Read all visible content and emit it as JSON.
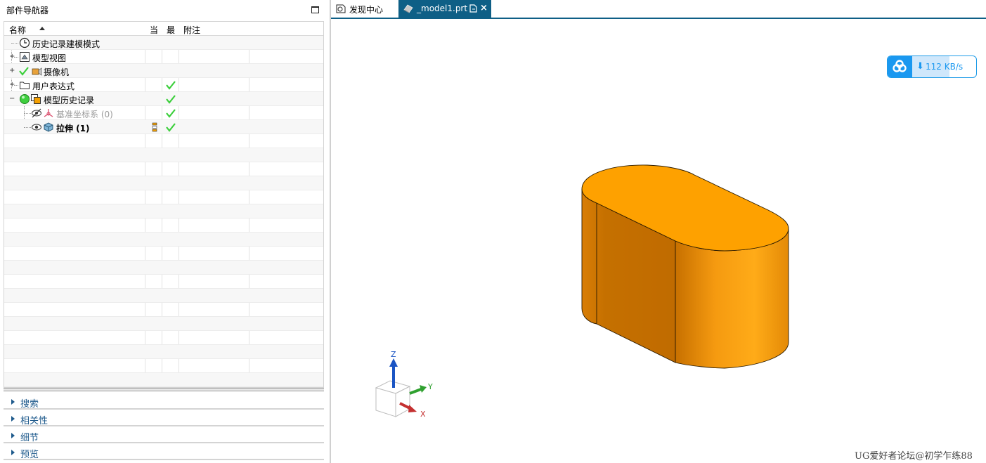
{
  "navigator": {
    "title": "部件导航器",
    "columns": {
      "name": "名称",
      "current": "当",
      "latest": "最",
      "comment": "附注"
    },
    "rows": [
      {
        "label": "历史记录建模模式",
        "latest_ok": false
      },
      {
        "label": "模型视图",
        "latest_ok": false
      },
      {
        "label": "摄像机",
        "latest_ok": false
      },
      {
        "label": "用户表达式",
        "latest_ok": true
      },
      {
        "label": "模型历史记录",
        "latest_ok": true
      },
      {
        "label": "基准坐标系 (0)",
        "latest_ok": true
      },
      {
        "label": "拉伸 (1)",
        "latest_ok": true
      }
    ],
    "sections": [
      "搜索",
      "相关性",
      "细节",
      "预览"
    ]
  },
  "tabs": {
    "discover": "发现中心",
    "model": "_model1.prt",
    "close_glyph": "×"
  },
  "viewport": {
    "speed": {
      "arrow": "⬇",
      "text": "112 KB/s",
      "fill_fraction": 0.58
    },
    "triad": {
      "z": "Z",
      "y": "Y",
      "x": "X"
    },
    "watermark": "UG爱好者论坛@初学乍练88",
    "colors": {
      "model_orange": "#f5a000",
      "tab_active": "#0e5f86",
      "section_text": "#1e5a8c",
      "check_green": "#3ccf3c"
    }
  }
}
